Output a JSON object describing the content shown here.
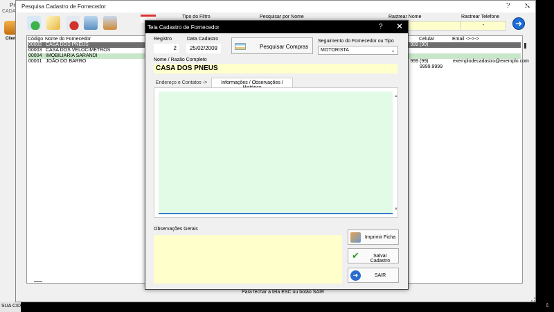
{
  "app": {
    "title_fragment": "Proj",
    "subtitle_fragment": "CADAS",
    "clients_label": "Clientes",
    "status_fragment": "SUA CIDADE"
  },
  "back_window": {
    "title": "Pesquisa Cadastro de Fornecedor",
    "help": "?",
    "close": "✕",
    "filters": {
      "tipo_label": "Tipo do Filtro",
      "nome_label": "Pesquisar por Nome",
      "rastrear_nome_label": "Rastrear Nome",
      "rastrear_tel_label": "Rastrear Telefone",
      "rastrear_tel_value": "-"
    },
    "go_icon": "arrow-right",
    "grid": {
      "headers": {
        "codigo": "Código",
        "nome": "Nome do Fornecedor",
        "celular": "Celular",
        "email": "Email ->->->"
      },
      "rows": [
        {
          "codigo": "00002",
          "nome": "CASA DOS PNEUS",
          "phone": "999",
          "celular": "(99) 9999.9999",
          "email": ""
        },
        {
          "codigo": "00003",
          "nome": "CASA DOS VELOCIMETROS",
          "phone": "",
          "celular": "",
          "email": ""
        },
        {
          "codigo": "00004",
          "nome": "IMOBILIARIA SARANDI",
          "phone": "",
          "celular": "",
          "email": ""
        },
        {
          "codigo": "00001",
          "nome": "JOÃO DO BARRO",
          "phone": "999",
          "celular": "(99) 9999.9999",
          "email": "exemplodecadastro@exemplo.com"
        }
      ]
    },
    "hint": "Para fechar a tela ESC ou botão SAIR"
  },
  "desktop": {
    "help": "?",
    "close": "✕",
    "updown": "⇕"
  },
  "dialog": {
    "title": "Tela Cadastro de Fornecedor",
    "help": "?",
    "close": "✕",
    "registro_label": "Registro",
    "registro_value": "2",
    "data_label": "Data Cadastro",
    "data_value": "25/02/2009",
    "compras_button": "Pesquisar Compras",
    "segmento_label": "Seguimento do Fornecedor ou Tipo",
    "segmento_value": "MOTORISTA",
    "nome_label": "Nome / Razão Completo",
    "nome_value": "CASA DOS PNEUS",
    "tabs": [
      "Endereço e Contatos ->",
      "Informações / Observações / Histórico"
    ],
    "obs_label": "Observações Gerais",
    "buttons": {
      "imprimir": "Imprimir Ficha",
      "salvar": "Salvar Cadastro",
      "sair": "SAIR"
    }
  }
}
